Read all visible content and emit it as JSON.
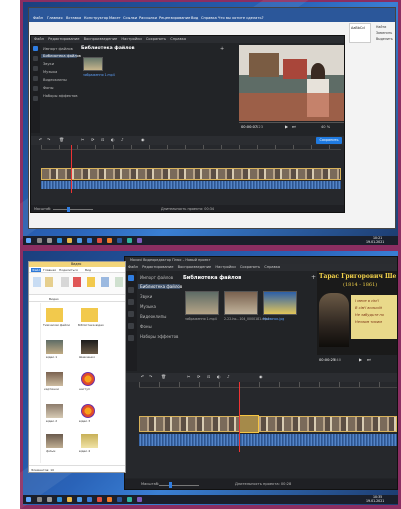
{
  "top": {
    "app_title": "Movavi Видеоредактор Плюс – Новый проект",
    "menu": [
      "Файл",
      "Редактирование",
      "Воспроизведение",
      "Настройки",
      "Сохранить",
      "Справка"
    ],
    "ribbon_tabs": [
      "Файл",
      "Главная",
      "Вставка",
      "Конструктор",
      "Макет",
      "Ссылки",
      "Рассылки",
      "Рецензирование",
      "Вид",
      "Справка",
      "Что вы хотите сделать?"
    ],
    "categories": [
      "Импорт файлов",
      "Библиотека файлов",
      "Звуки",
      "Музыка",
      "Видеоклипы",
      "Фоны",
      "Наборы эффектов"
    ],
    "panel_title": "Библиотека файлов",
    "thumb_label": "зображення 1.mp4",
    "timecode": "00:00:07",
    "timecode_ms": ".123",
    "zoom": "40 %",
    "save_label": "Сохранить",
    "tooltip_title": "Разрезать",
    "tooltip_body": "Разрезать выбранный клип в позиции воспроизведения",
    "scale_label": "Масштаб:",
    "duration_label": "Длительность проекта: 00:34",
    "side_header": "AaBbCcI",
    "side_items": [
      "Найти",
      "Заменить",
      "Выделить"
    ],
    "tray_time": "10:21",
    "tray_date": "19.01.2021"
  },
  "bottom": {
    "app_title": "Movavi Видеоредактор Плюс – Новый проект",
    "menu": [
      "Файл",
      "Редактирование",
      "Воспроизведение",
      "Настройки",
      "Сохранить",
      "Справка"
    ],
    "categories": [
      "Импорт файлов",
      "Библиотека файлов",
      "Звуки",
      "Музыка",
      "Видеоклипы",
      "Фоны",
      "Наборы эффектов"
    ],
    "panel_title": "Библиотека файлов",
    "thumbs": [
      "зображення 1.mp4",
      "2-22-ho...104_0000181.mp4",
      "Малюнок.jpg"
    ],
    "preview_title": "Тарас Григорович Ше",
    "preview_years": "(1814 - 1861)",
    "poem_lines": [
      "І мене в сім'ї",
      "В сім'ї вольній",
      "Не забудьте по",
      "Незлим тихим"
    ],
    "timecode": "00:00:25",
    "timecode_ms": ".540",
    "scale_label": "Масштаб:",
    "duration_label": "Длительность проекта: 00:28",
    "explorer": {
      "title": "Видео",
      "tabs": [
        "Файл",
        "Главная",
        "Поделиться",
        "Вид"
      ],
      "address": "Видео",
      "files": [
        "Тимчасові файли",
        "Бібліотека відео",
        "відео 1",
        "Шевченко",
        "картинки",
        "наступ",
        "відео 2",
        "відео 3",
        "фільм",
        "відео 4"
      ],
      "status": "Элементов: 10"
    },
    "tray_time": "10:35",
    "tray_date": "19.01.2021"
  }
}
